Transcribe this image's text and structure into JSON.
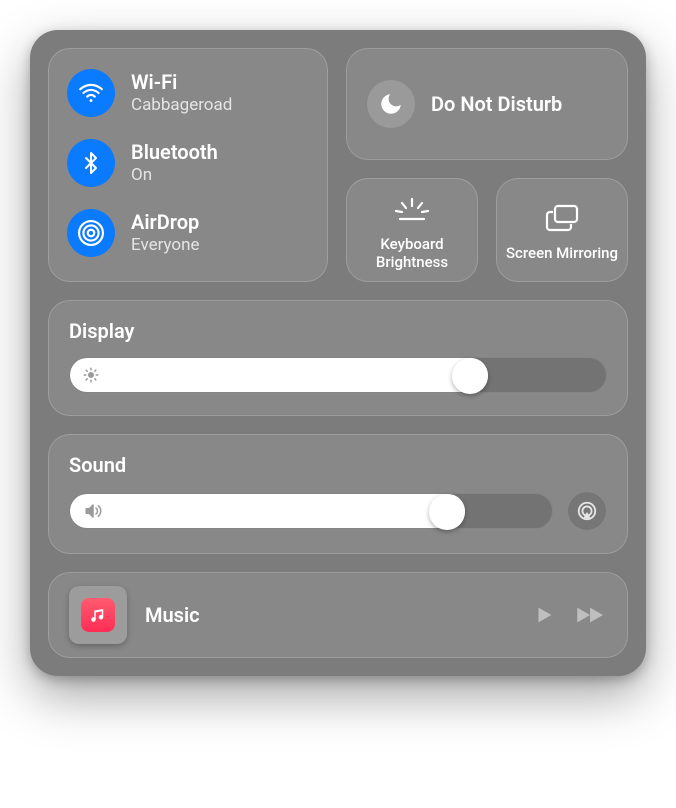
{
  "connectivity": {
    "wifi": {
      "title": "Wi-Fi",
      "subtitle": "Cabbageroad",
      "active": true
    },
    "bluetooth": {
      "title": "Bluetooth",
      "subtitle": "On",
      "active": true
    },
    "airdrop": {
      "title": "AirDrop",
      "subtitle": "Everyone",
      "active": true
    }
  },
  "dnd": {
    "title": "Do Not Disturb",
    "active": false
  },
  "small_tiles": {
    "keyboard_brightness": "Keyboard Brightness",
    "screen_mirroring": "Screen Mirroring"
  },
  "display": {
    "title": "Display",
    "value_percent": 78
  },
  "sound": {
    "title": "Sound",
    "value_percent": 82
  },
  "media": {
    "app": "Music"
  },
  "colors": {
    "accent_blue": "#0a7aff",
    "music_red": "#ff2d55"
  }
}
